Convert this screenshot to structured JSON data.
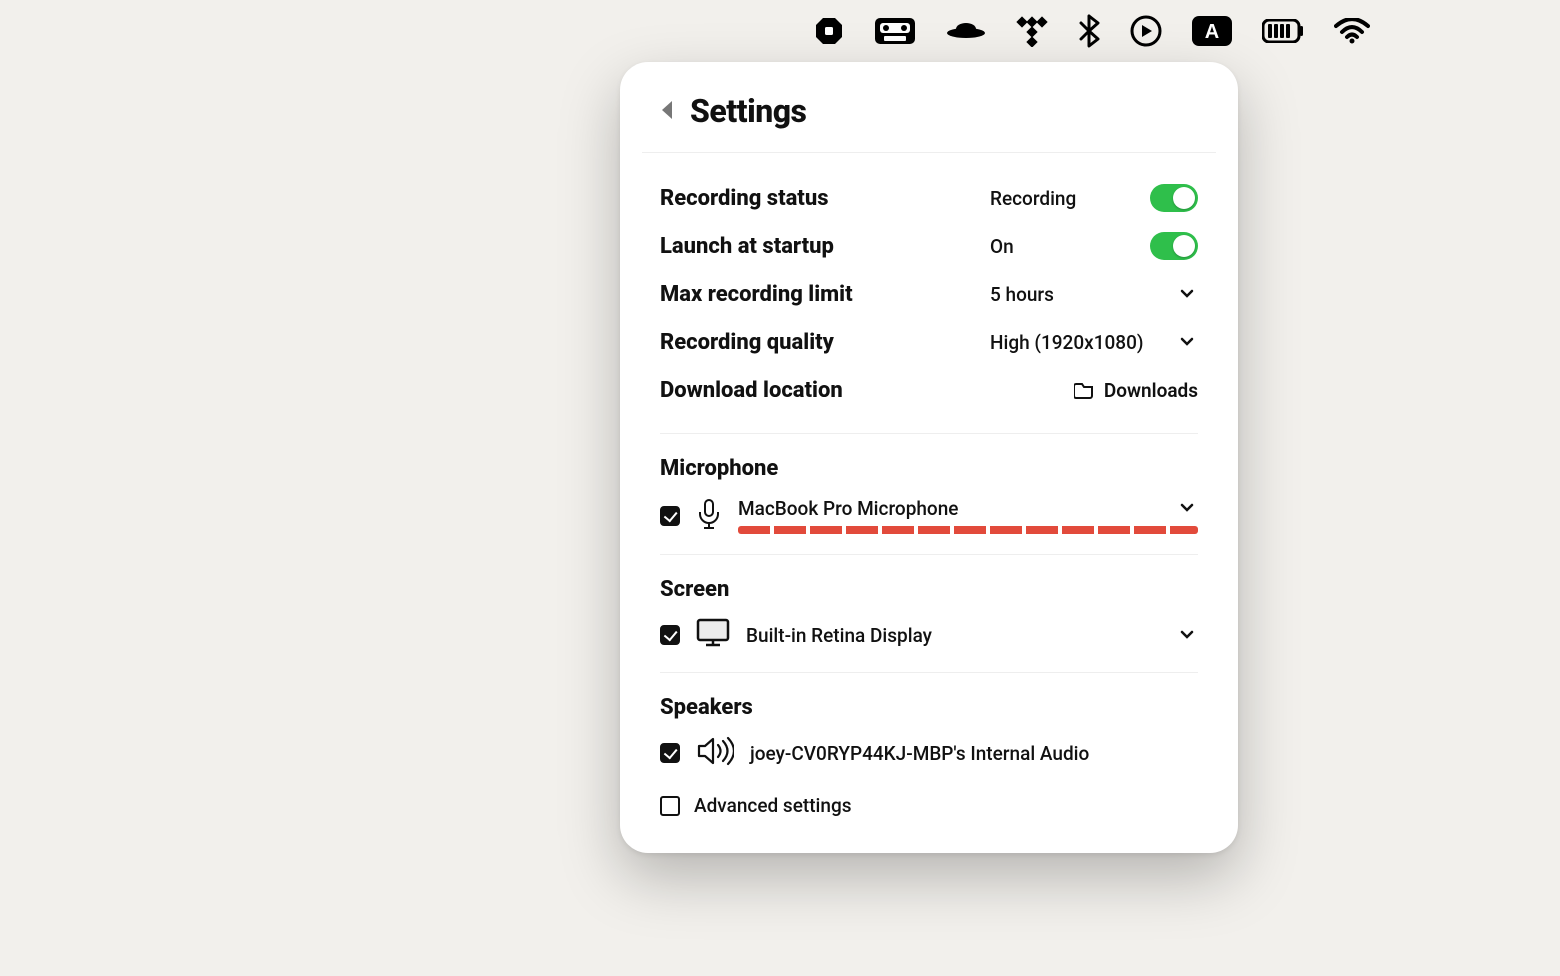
{
  "menubar": {
    "icons": [
      "stop",
      "cassette",
      "ufo",
      "tidal",
      "bluetooth",
      "play-circle",
      "input-a",
      "battery",
      "wifi"
    ]
  },
  "panel": {
    "title": "Settings",
    "rows": {
      "recording_status": {
        "label": "Recording status",
        "value": "Recording",
        "toggle_on": true
      },
      "launch_at_startup": {
        "label": "Launch at startup",
        "value": "On",
        "toggle_on": true
      },
      "max_recording_limit": {
        "label": "Max recording limit",
        "value": "5 hours"
      },
      "recording_quality": {
        "label": "Recording quality",
        "value": "High (1920x1080)"
      },
      "download_location": {
        "label": "Download location",
        "value": "Downloads"
      }
    },
    "microphone": {
      "heading": "Microphone",
      "checked": true,
      "device": "MacBook Pro Microphone",
      "level_color": "#e24a3b"
    },
    "screen": {
      "heading": "Screen",
      "checked": true,
      "device": "Built-in Retina Display"
    },
    "speakers": {
      "heading": "Speakers",
      "checked": true,
      "device": "joey-CV0RYP44KJ-MBP's Internal Audio"
    },
    "advanced": {
      "label": "Advanced settings",
      "checked": false
    }
  }
}
